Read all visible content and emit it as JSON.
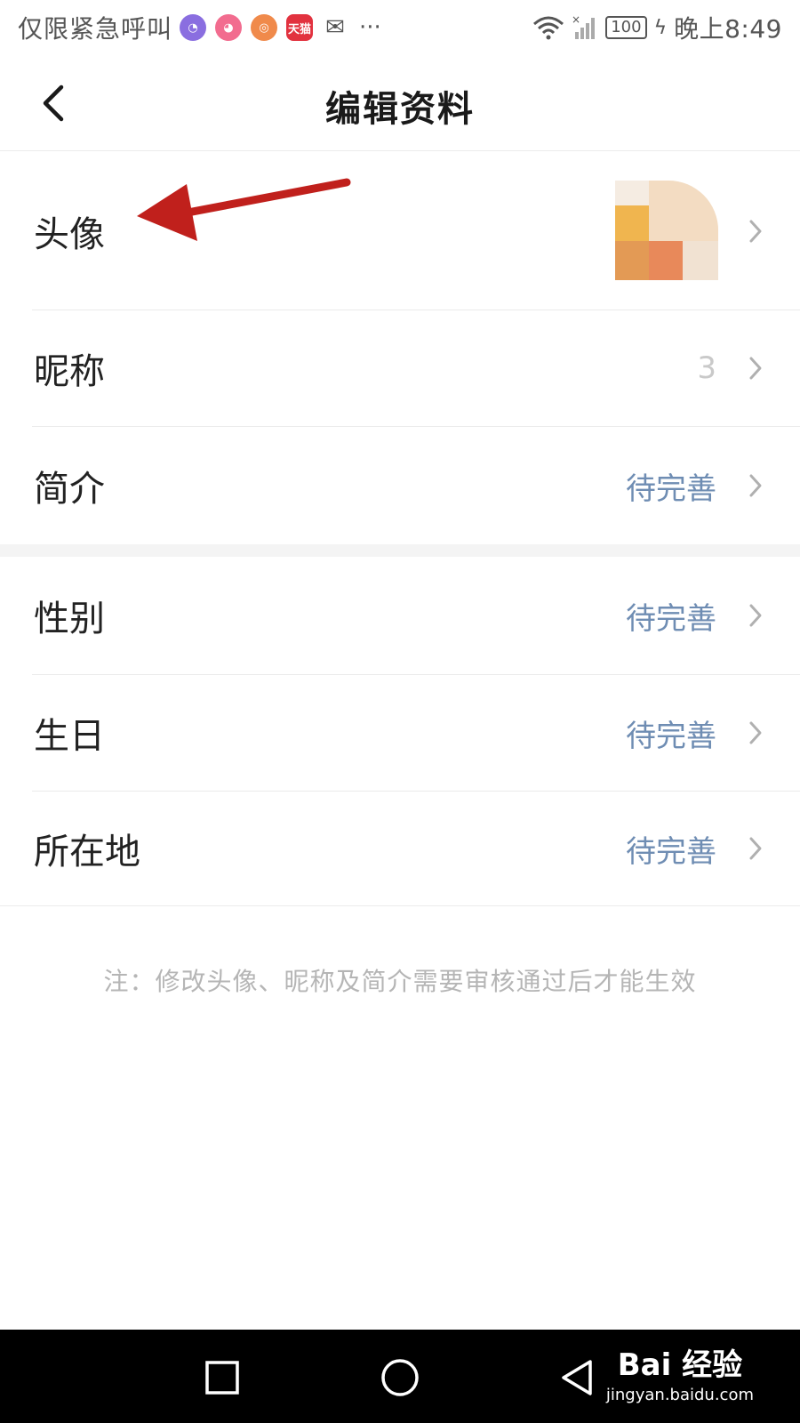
{
  "status_bar": {
    "carrier": "仅限紧急呼叫",
    "notif_icons": [
      "app-icon",
      "app-icon",
      "app-icon",
      "tmall-icon",
      "wechat-icon"
    ],
    "tmall_label": "天猫",
    "more": "···",
    "battery": "100",
    "time": "晚上8:49"
  },
  "header": {
    "title": "编辑资料"
  },
  "rows": [
    {
      "label": "头像",
      "value": ""
    },
    {
      "label": "昵称",
      "value": "3"
    },
    {
      "label": "简介",
      "value": "待完善"
    },
    {
      "label": "性别",
      "value": "待完善"
    },
    {
      "label": "生日",
      "value": "待完善"
    },
    {
      "label": "所在地",
      "value": "待完善"
    }
  ],
  "note": "注：修改头像、昵称及简介需要审核通过后才能生效",
  "watermark": {
    "brand": "Bai 经验",
    "url": "jingyan.baidu.com"
  },
  "colors": {
    "value_text": "#6f8db3",
    "arrow": "#c0201c",
    "note_text": "#b5b5b5"
  }
}
